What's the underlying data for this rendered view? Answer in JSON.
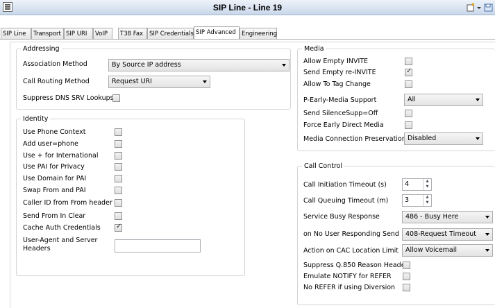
{
  "window": {
    "title": "SIP Line - Line 19"
  },
  "tabs": [
    "SIP Line",
    "Transport",
    "SIP URI",
    "VoIP",
    "T38 Fax",
    "SIP Credentials",
    "SIP Advanced",
    "Engineering"
  ],
  "active_tab": "SIP Advanced",
  "addressing": {
    "legend": "Addressing",
    "association_method_label": "Association Method",
    "association_method_value": "By Source IP address",
    "call_routing_method_label": "Call Routing Method",
    "call_routing_method_value": "Request URI",
    "suppress_dns_label": "Suppress DNS SRV Lookups",
    "suppress_dns_checked": false
  },
  "identity": {
    "legend": "Identity",
    "items": [
      {
        "label": "Use Phone Context",
        "checked": false
      },
      {
        "label": "Add user=phone",
        "checked": false
      },
      {
        "label": "Use + for International",
        "checked": false
      },
      {
        "label": "Use PAI for Privacy",
        "checked": false
      },
      {
        "label": "Use Domain for PAI",
        "checked": false
      },
      {
        "label": "Swap From and PAI",
        "checked": false
      },
      {
        "label": "Caller ID from From header",
        "checked": false
      },
      {
        "label": "Send From In Clear",
        "checked": false
      },
      {
        "label": "Cache Auth Credentials",
        "checked": true
      }
    ],
    "user_agent_label_1": "User-Agent and Server",
    "user_agent_label_2": "Headers",
    "user_agent_value": ""
  },
  "media": {
    "legend": "Media",
    "allow_empty_invite_label": "Allow Empty INVITE",
    "allow_empty_invite_checked": false,
    "send_empty_reinvite_label": "Send Empty re-INVITE",
    "send_empty_reinvite_checked": true,
    "allow_to_tag_change_label": "Allow To Tag Change",
    "allow_to_tag_change_checked": false,
    "p_early_media_label": "P-Early-Media Support",
    "p_early_media_value": "All",
    "send_silencesupp_label": "Send SilenceSupp=Off",
    "send_silencesupp_checked": false,
    "force_early_direct_label": "Force Early Direct Media",
    "force_early_direct_checked": false,
    "media_connection_label": "Media Connection Preservation",
    "media_connection_value": "Disabled"
  },
  "call_control": {
    "legend": "Call Control",
    "call_initiation_label": "Call Initiation Timeout (s)",
    "call_initiation_value": "4",
    "call_queuing_label": "Call Queuing Timeout (m)",
    "call_queuing_value": "3",
    "service_busy_label": "Service Busy Response",
    "service_busy_value": "486 - Busy Here",
    "no_user_responding_label": "on No User Responding Send",
    "no_user_responding_value": "408-Request Timeout",
    "cac_label": "Action on CAC Location Limit",
    "cac_value": "Allow Voicemail",
    "suppress_q850_label": "Suppress Q.850 Reason Header",
    "suppress_q850_checked": false,
    "emulate_notify_label": "Emulate NOTIFY for REFER",
    "emulate_notify_checked": false,
    "no_refer_label": "No REFER if using Diversion",
    "no_refer_checked": false
  }
}
